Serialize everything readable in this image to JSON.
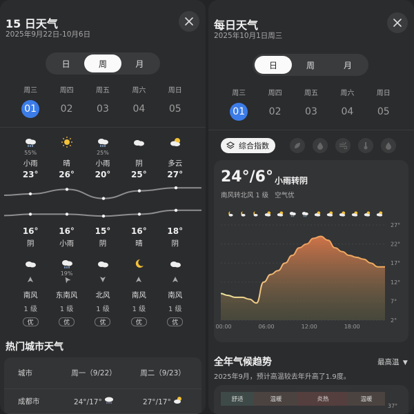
{
  "left": {
    "title": "15 日天气",
    "subtitle": "2025年9月22日-10月6日",
    "tabs": [
      {
        "label": "日",
        "active": false
      },
      {
        "label": "周",
        "active": true
      },
      {
        "label": "月",
        "active": false
      }
    ],
    "days": [
      {
        "weekday": "周三",
        "date": "01",
        "selected": true,
        "day_icon": "cloud-rain-icon",
        "day_pct": "55%",
        "day_cond": "小雨",
        "high": "23°",
        "low": "16°",
        "night_cond": "阴",
        "night_icon": "cloud-icon",
        "night_pct": "",
        "wind_dir": "南风",
        "wind_level": "1 级",
        "aqi": "优",
        "arrow": "up"
      },
      {
        "weekday": "周四",
        "date": "02",
        "selected": false,
        "day_icon": "sun-icon",
        "day_pct": "",
        "day_cond": "晴",
        "high": "26°",
        "low": "16°",
        "night_cond": "小雨",
        "night_icon": "cloud-rain-icon",
        "night_pct": "19%",
        "wind_dir": "东南风",
        "wind_level": "1 级",
        "aqi": "优",
        "arrow": "up-left"
      },
      {
        "weekday": "周五",
        "date": "03",
        "selected": false,
        "day_icon": "cloud-rain-icon",
        "day_pct": "25%",
        "day_cond": "小雨",
        "high": "20°",
        "low": "15°",
        "night_cond": "阴",
        "night_icon": "cloud-icon",
        "night_pct": "",
        "wind_dir": "北风",
        "wind_level": "1 级",
        "aqi": "优",
        "arrow": "down"
      },
      {
        "weekday": "周六",
        "date": "04",
        "selected": false,
        "day_icon": "cloud-icon",
        "day_pct": "",
        "day_cond": "阴",
        "high": "25°",
        "low": "16°",
        "night_cond": "晴",
        "night_icon": "moon-icon",
        "night_pct": "",
        "wind_dir": "南风",
        "wind_level": "1 级",
        "aqi": "优",
        "arrow": "up"
      },
      {
        "weekday": "周日",
        "date": "05",
        "selected": false,
        "day_icon": "sun-cloud-icon",
        "day_pct": "",
        "day_cond": "多云",
        "high": "27°",
        "low": "18°",
        "night_cond": "阴",
        "night_icon": "cloud-icon",
        "night_pct": "",
        "wind_dir": "南风",
        "wind_level": "1 级",
        "aqi": "优",
        "arrow": "up"
      }
    ],
    "high_values": [
      23,
      26,
      20,
      25,
      27
    ],
    "low_values": [
      16,
      16,
      15,
      16,
      18
    ],
    "hot_cities": {
      "title": "热门城市天气",
      "headers": [
        "城市",
        "周一（9/22）",
        "周二（9/23）"
      ],
      "rows": [
        {
          "city": "成都市",
          "d1": "24°/17°",
          "d1_icon": "cloud-rain-icon",
          "d2": "27°/17°",
          "d2_icon": "sun-cloud-icon"
        }
      ]
    }
  },
  "right": {
    "title": "每日天气",
    "subtitle": "2025年10月1日周三",
    "tabs": [
      {
        "label": "日",
        "active": true
      },
      {
        "label": "周",
        "active": false
      },
      {
        "label": "月",
        "active": false
      }
    ],
    "days": [
      {
        "weekday": "周三",
        "date": "01",
        "selected": true
      },
      {
        "weekday": "周四",
        "date": "02",
        "selected": false
      },
      {
        "weekday": "周五",
        "date": "03",
        "selected": false
      },
      {
        "weekday": "周六",
        "date": "04",
        "selected": false
      },
      {
        "weekday": "周日",
        "date": "05",
        "selected": false
      }
    ],
    "index_chip": "综合指数",
    "index_icons": [
      "leaf-icon",
      "drop-icon",
      "wind-icon",
      "thermometer-icon",
      "drop-small-icon"
    ],
    "temp_range": "24°/6°",
    "condition": "小雨转阴",
    "meta": "南风转北风 1 级   空气优",
    "hourly_icons": [
      "moon-cloud-icon",
      "moon-cloud-icon",
      "moon-cloud-icon",
      "sun-cloud-icon",
      "sun-cloud-icon",
      "cloud-rain-icon",
      "cloud-rain-icon",
      "sun-cloud-icon",
      "sun-cloud-icon",
      "sun-cloud-icon",
      "sun-cloud-icon",
      "sun-cloud-icon",
      "sun-cloud-icon"
    ],
    "trend_title": "全年气候趋势",
    "trend_select": "最高温",
    "trend_desc": "2025年9月，预计高温较去年升高了1.9度。",
    "trend_bands": [
      "舒适",
      "温暖",
      "炎热",
      "温暖"
    ],
    "trend_axis_top": "37°"
  },
  "colors": {
    "accent": "#3c7ce8",
    "chart_line_cool": "#f2e9a0",
    "chart_line_warm": "#f0a060"
  },
  "chart_data": {
    "type": "area",
    "x": [
      "00:00",
      "01:00",
      "02:00",
      "03:00",
      "04:00",
      "05:00",
      "06:00",
      "07:00",
      "08:00",
      "09:00",
      "10:00",
      "11:00",
      "12:00",
      "13:00",
      "14:00",
      "15:00",
      "16:00",
      "17:00",
      "18:00",
      "19:00",
      "20:00",
      "21:00",
      "22:00",
      "23:00"
    ],
    "values": [
      9,
      8.5,
      8,
      8,
      7.5,
      6.5,
      12,
      14,
      15,
      17,
      19,
      21,
      22,
      23.5,
      24,
      23,
      21,
      20,
      19,
      18.5,
      18,
      17,
      16,
      16
    ],
    "xticks": [
      "00:00",
      "06:00",
      "12:00",
      "18:00"
    ],
    "yticks": [
      "2°",
      "7°",
      "12°",
      "17°",
      "22°",
      "27°"
    ],
    "ylim": [
      2,
      27
    ]
  }
}
